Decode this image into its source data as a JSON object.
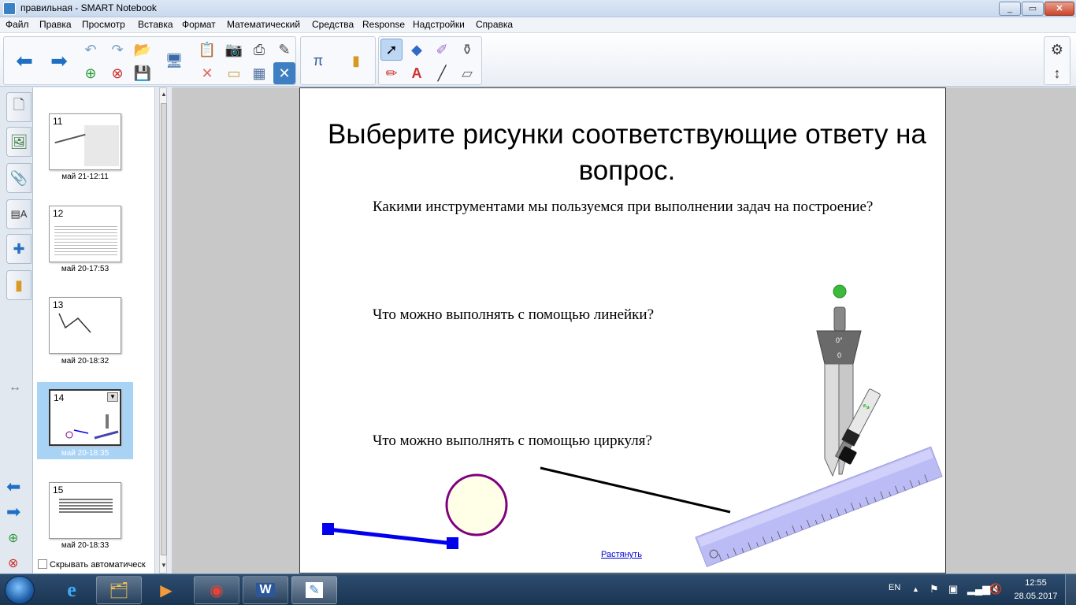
{
  "window": {
    "title": "правильная - SMART Notebook"
  },
  "menu": [
    "Файл",
    "Правка",
    "Просмотр",
    "Вставка",
    "Формат",
    "Математический",
    "Средства",
    "Response",
    "Надстройки",
    "Справка"
  ],
  "sorter": {
    "pages": [
      {
        "num": "11",
        "label": "май 21-12:11"
      },
      {
        "num": "12",
        "label": "май 20-17:53"
      },
      {
        "num": "13",
        "label": "май 20-18:32"
      },
      {
        "num": "14",
        "label": "май 20-18:35"
      },
      {
        "num": "15",
        "label": "май 20-18:33"
      }
    ],
    "hide_label": "Скрывать автоматическ"
  },
  "page": {
    "title": "Выберите  рисунки соответствующие ответу на вопрос.",
    "question1": "Какими инструментами мы пользуемся при выполнении задач на построение?",
    "question2": "Что можно выполнять с помощью линейки?",
    "question3": "Что можно выполнять с помощью циркуля?",
    "stretch_link": "Растянуть",
    "compass_readout_deg": "0°",
    "compass_readout_val": "0"
  },
  "taskbar": {
    "lang": "EN",
    "time": "12:55",
    "date": "28.05.2017"
  },
  "colors": {
    "accent": "#3b82c4",
    "segment_blue": "#0000ee",
    "circle_border": "#800080",
    "circle_fill": "#ffffe8",
    "ruler": "#b8b8f6",
    "compass_dot": "#3cba3c"
  }
}
